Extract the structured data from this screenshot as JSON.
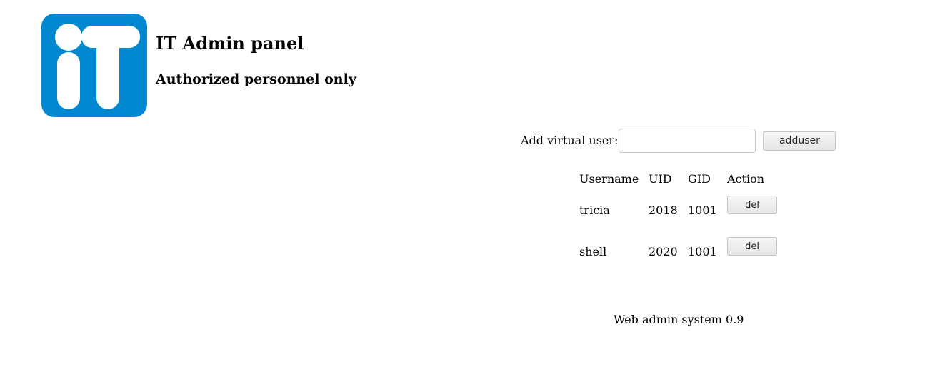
{
  "header": {
    "title": "IT Admin panel",
    "subtitle": "Authorized personnel only",
    "logo_icon": "it-logo-icon",
    "logo_color": "#0288d1"
  },
  "add_user": {
    "label": "Add virtual user:",
    "input_value": "",
    "input_placeholder": "",
    "button_label": "adduser"
  },
  "users_table": {
    "columns": [
      "Username",
      "UID",
      "GID",
      "Action"
    ],
    "rows": [
      {
        "username": "tricia",
        "uid": "2018",
        "gid": "1001",
        "action_label": "del"
      },
      {
        "username": "shell",
        "uid": "2020",
        "gid": "1001",
        "action_label": "del"
      }
    ]
  },
  "footer": {
    "text": "Web admin system 0.9"
  }
}
